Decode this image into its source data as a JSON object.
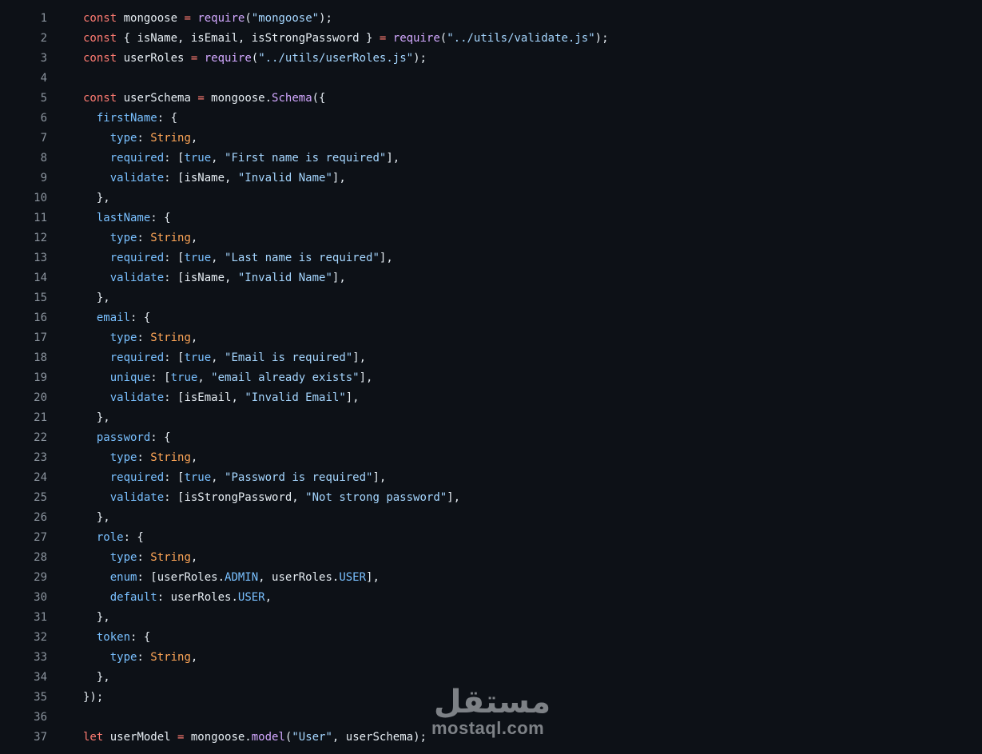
{
  "editor": {
    "lines": [
      {
        "n": "1",
        "tokens": [
          [
            "kw",
            "const"
          ],
          [
            "plain",
            " mongoose "
          ],
          [
            "op",
            "="
          ],
          [
            "plain",
            " "
          ],
          [
            "fn",
            "require"
          ],
          [
            "plain",
            "("
          ],
          [
            "str",
            "\"mongoose\""
          ],
          [
            "plain",
            ");"
          ]
        ]
      },
      {
        "n": "2",
        "tokens": [
          [
            "kw",
            "const"
          ],
          [
            "plain",
            " { isName, isEmail, isStrongPassword } "
          ],
          [
            "op",
            "="
          ],
          [
            "plain",
            " "
          ],
          [
            "fn",
            "require"
          ],
          [
            "plain",
            "("
          ],
          [
            "str",
            "\"../utils/validate.js\""
          ],
          [
            "plain",
            ");"
          ]
        ]
      },
      {
        "n": "3",
        "tokens": [
          [
            "kw",
            "const"
          ],
          [
            "plain",
            " userRoles "
          ],
          [
            "op",
            "="
          ],
          [
            "plain",
            " "
          ],
          [
            "fn",
            "require"
          ],
          [
            "plain",
            "("
          ],
          [
            "str",
            "\"../utils/userRoles.js\""
          ],
          [
            "plain",
            ");"
          ]
        ]
      },
      {
        "n": "4",
        "tokens": []
      },
      {
        "n": "5",
        "tokens": [
          [
            "kw",
            "const"
          ],
          [
            "plain",
            " userSchema "
          ],
          [
            "op",
            "="
          ],
          [
            "plain",
            " mongoose."
          ],
          [
            "fn",
            "Schema"
          ],
          [
            "plain",
            "({"
          ]
        ]
      },
      {
        "n": "6",
        "tokens": [
          [
            "plain",
            "  "
          ],
          [
            "prop",
            "firstName"
          ],
          [
            "plain",
            ": {"
          ]
        ]
      },
      {
        "n": "7",
        "tokens": [
          [
            "plain",
            "    "
          ],
          [
            "prop",
            "type"
          ],
          [
            "plain",
            ": "
          ],
          [
            "type",
            "String"
          ],
          [
            "plain",
            ","
          ]
        ]
      },
      {
        "n": "8",
        "tokens": [
          [
            "plain",
            "    "
          ],
          [
            "prop",
            "required"
          ],
          [
            "plain",
            ": ["
          ],
          [
            "const",
            "true"
          ],
          [
            "plain",
            ", "
          ],
          [
            "str",
            "\"First name is required\""
          ],
          [
            "plain",
            "],"
          ]
        ]
      },
      {
        "n": "9",
        "tokens": [
          [
            "plain",
            "    "
          ],
          [
            "prop",
            "validate"
          ],
          [
            "plain",
            ": [isName, "
          ],
          [
            "str",
            "\"Invalid Name\""
          ],
          [
            "plain",
            "],"
          ]
        ]
      },
      {
        "n": "10",
        "tokens": [
          [
            "plain",
            "  },"
          ]
        ]
      },
      {
        "n": "11",
        "tokens": [
          [
            "plain",
            "  "
          ],
          [
            "prop",
            "lastName"
          ],
          [
            "plain",
            ": {"
          ]
        ]
      },
      {
        "n": "12",
        "tokens": [
          [
            "plain",
            "    "
          ],
          [
            "prop",
            "type"
          ],
          [
            "plain",
            ": "
          ],
          [
            "type",
            "String"
          ],
          [
            "plain",
            ","
          ]
        ]
      },
      {
        "n": "13",
        "tokens": [
          [
            "plain",
            "    "
          ],
          [
            "prop",
            "required"
          ],
          [
            "plain",
            ": ["
          ],
          [
            "const",
            "true"
          ],
          [
            "plain",
            ", "
          ],
          [
            "str",
            "\"Last name is required\""
          ],
          [
            "plain",
            "],"
          ]
        ]
      },
      {
        "n": "14",
        "tokens": [
          [
            "plain",
            "    "
          ],
          [
            "prop",
            "validate"
          ],
          [
            "plain",
            ": [isName, "
          ],
          [
            "str",
            "\"Invalid Name\""
          ],
          [
            "plain",
            "],"
          ]
        ]
      },
      {
        "n": "15",
        "tokens": [
          [
            "plain",
            "  },"
          ]
        ]
      },
      {
        "n": "16",
        "tokens": [
          [
            "plain",
            "  "
          ],
          [
            "prop",
            "email"
          ],
          [
            "plain",
            ": {"
          ]
        ]
      },
      {
        "n": "17",
        "tokens": [
          [
            "plain",
            "    "
          ],
          [
            "prop",
            "type"
          ],
          [
            "plain",
            ": "
          ],
          [
            "type",
            "String"
          ],
          [
            "plain",
            ","
          ]
        ]
      },
      {
        "n": "18",
        "tokens": [
          [
            "plain",
            "    "
          ],
          [
            "prop",
            "required"
          ],
          [
            "plain",
            ": ["
          ],
          [
            "const",
            "true"
          ],
          [
            "plain",
            ", "
          ],
          [
            "str",
            "\"Email is required\""
          ],
          [
            "plain",
            "],"
          ]
        ]
      },
      {
        "n": "19",
        "tokens": [
          [
            "plain",
            "    "
          ],
          [
            "prop",
            "unique"
          ],
          [
            "plain",
            ": ["
          ],
          [
            "const",
            "true"
          ],
          [
            "plain",
            ", "
          ],
          [
            "str",
            "\"email already exists\""
          ],
          [
            "plain",
            "],"
          ]
        ]
      },
      {
        "n": "20",
        "tokens": [
          [
            "plain",
            "    "
          ],
          [
            "prop",
            "validate"
          ],
          [
            "plain",
            ": [isEmail, "
          ],
          [
            "str",
            "\"Invalid Email\""
          ],
          [
            "plain",
            "],"
          ]
        ]
      },
      {
        "n": "21",
        "tokens": [
          [
            "plain",
            "  },"
          ]
        ]
      },
      {
        "n": "22",
        "tokens": [
          [
            "plain",
            "  "
          ],
          [
            "prop",
            "password"
          ],
          [
            "plain",
            ": {"
          ]
        ]
      },
      {
        "n": "23",
        "tokens": [
          [
            "plain",
            "    "
          ],
          [
            "prop",
            "type"
          ],
          [
            "plain",
            ": "
          ],
          [
            "type",
            "String"
          ],
          [
            "plain",
            ","
          ]
        ]
      },
      {
        "n": "24",
        "tokens": [
          [
            "plain",
            "    "
          ],
          [
            "prop",
            "required"
          ],
          [
            "plain",
            ": ["
          ],
          [
            "const",
            "true"
          ],
          [
            "plain",
            ", "
          ],
          [
            "str",
            "\"Password is required\""
          ],
          [
            "plain",
            "],"
          ]
        ]
      },
      {
        "n": "25",
        "tokens": [
          [
            "plain",
            "    "
          ],
          [
            "prop",
            "validate"
          ],
          [
            "plain",
            ": [isStrongPassword, "
          ],
          [
            "str",
            "\"Not strong password\""
          ],
          [
            "plain",
            "],"
          ]
        ]
      },
      {
        "n": "26",
        "tokens": [
          [
            "plain",
            "  },"
          ]
        ]
      },
      {
        "n": "27",
        "tokens": [
          [
            "plain",
            "  "
          ],
          [
            "prop",
            "role"
          ],
          [
            "plain",
            ": {"
          ]
        ]
      },
      {
        "n": "28",
        "tokens": [
          [
            "plain",
            "    "
          ],
          [
            "prop",
            "type"
          ],
          [
            "plain",
            ": "
          ],
          [
            "type",
            "String"
          ],
          [
            "plain",
            ","
          ]
        ]
      },
      {
        "n": "29",
        "tokens": [
          [
            "plain",
            "    "
          ],
          [
            "prop",
            "enum"
          ],
          [
            "plain",
            ": [userRoles."
          ],
          [
            "member",
            "ADMIN"
          ],
          [
            "plain",
            ", userRoles."
          ],
          [
            "member",
            "USER"
          ],
          [
            "plain",
            "],"
          ]
        ]
      },
      {
        "n": "30",
        "tokens": [
          [
            "plain",
            "    "
          ],
          [
            "prop",
            "default"
          ],
          [
            "plain",
            ": userRoles."
          ],
          [
            "member",
            "USER"
          ],
          [
            "plain",
            ","
          ]
        ]
      },
      {
        "n": "31",
        "tokens": [
          [
            "plain",
            "  },"
          ]
        ]
      },
      {
        "n": "32",
        "tokens": [
          [
            "plain",
            "  "
          ],
          [
            "prop",
            "token"
          ],
          [
            "plain",
            ": {"
          ]
        ]
      },
      {
        "n": "33",
        "tokens": [
          [
            "plain",
            "    "
          ],
          [
            "prop",
            "type"
          ],
          [
            "plain",
            ": "
          ],
          [
            "type",
            "String"
          ],
          [
            "plain",
            ","
          ]
        ]
      },
      {
        "n": "34",
        "tokens": [
          [
            "plain",
            "  },"
          ]
        ]
      },
      {
        "n": "35",
        "tokens": [
          [
            "plain",
            "});"
          ]
        ]
      },
      {
        "n": "36",
        "tokens": []
      },
      {
        "n": "37",
        "tokens": [
          [
            "kw",
            "let"
          ],
          [
            "plain",
            " userModel "
          ],
          [
            "op",
            "="
          ],
          [
            "plain",
            " mongoose."
          ],
          [
            "fn",
            "model"
          ],
          [
            "plain",
            "("
          ],
          [
            "str",
            "\"User\""
          ],
          [
            "plain",
            ", userSchema);"
          ]
        ]
      }
    ]
  },
  "watermark": {
    "arabic": "مستقل",
    "latin": "mostaql.com"
  }
}
